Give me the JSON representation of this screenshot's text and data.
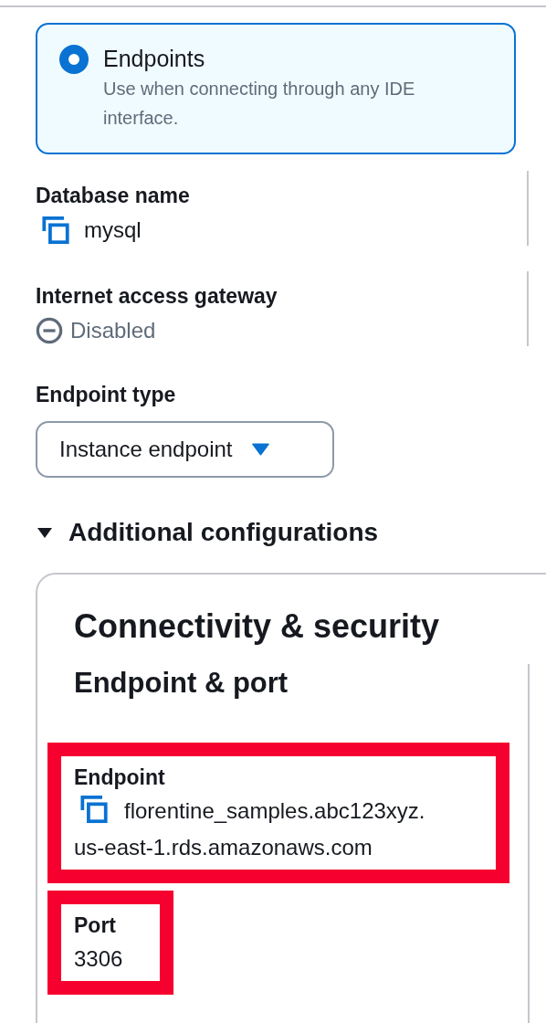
{
  "selection_card": {
    "label": "Endpoints",
    "description": "Use when connecting through any IDE interface.",
    "selected": true
  },
  "fields": [
    {
      "kind": "copy",
      "label": "Database name",
      "value": "mysql"
    },
    {
      "kind": "status",
      "label": "Internet access gateway",
      "value": "Disabled"
    }
  ],
  "endpoint_type": {
    "label": "Endpoint type",
    "value": "Instance endpoint"
  },
  "additional_configurations": {
    "label": "Additional configurations",
    "expanded": true,
    "section": {
      "title": "Connectivity & security",
      "subtitle": "Endpoint & port",
      "fields": [
        {
          "kind": "copy",
          "label": "Endpoint",
          "value_lines": [
            "florentine_samples.abc123xyz.",
            "us-east-1.rds.amazonaws.com"
          ],
          "highlighted": true
        },
        {
          "kind": "plain",
          "label": "Port",
          "value_lines": [
            "3306"
          ],
          "highlighted": true
        }
      ]
    }
  }
}
